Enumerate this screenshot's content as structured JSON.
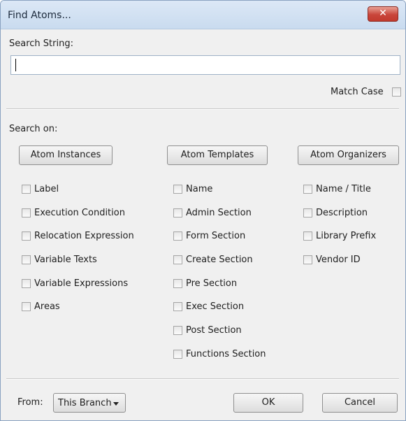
{
  "window": {
    "title": "Find Atoms...",
    "close_glyph": "✕"
  },
  "search": {
    "label": "Search String:",
    "value": ""
  },
  "match_case": {
    "label": "Match Case",
    "checked": false
  },
  "search_on_label": "Search on:",
  "groups": {
    "instances": {
      "button": "Atom Instances",
      "options": [
        "Label",
        "Execution Condition",
        "Relocation Expression",
        "Variable Texts",
        "Variable Expressions",
        "Areas"
      ]
    },
    "templates": {
      "button": "Atom Templates",
      "options": [
        "Name",
        "Admin Section",
        "Form Section",
        "Create Section",
        "Pre Section",
        "Exec Section",
        "Post Section",
        "Functions Section"
      ]
    },
    "organizers": {
      "button": "Atom Organizers",
      "options": [
        "Name / Title",
        "Description",
        "Library Prefix",
        "Vendor ID"
      ]
    }
  },
  "footer": {
    "from_label": "From:",
    "from_value": "This Branch",
    "ok": "OK",
    "cancel": "Cancel"
  }
}
